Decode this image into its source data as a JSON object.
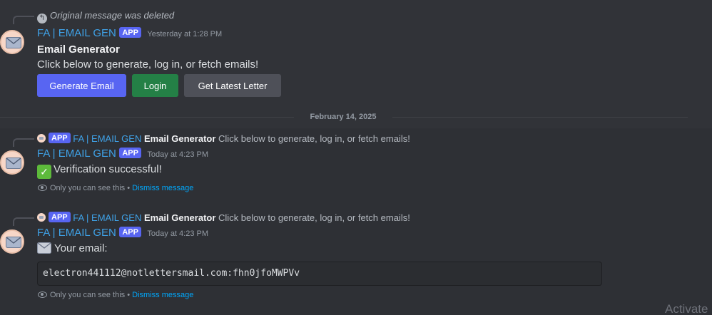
{
  "msg1": {
    "reply_text": "Original message was deleted",
    "username": "FA | EMAIL GEN",
    "tag": "APP",
    "timestamp": "Yesterday at 1:28 PM",
    "title": "Email Generator",
    "body": "Click below to generate, log in, or fetch emails!",
    "buttons": {
      "generate": "Generate Email",
      "login": "Login",
      "latest": "Get Latest Letter"
    }
  },
  "divider": {
    "date": "February 14, 2025"
  },
  "msg2": {
    "ref": {
      "tag": "APP",
      "name": "FA | EMAIL GEN",
      "bold": "Email Generator",
      "text": "Click below to generate, log in, or fetch emails!"
    },
    "username": "FA | EMAIL GEN",
    "tag": "APP",
    "timestamp": "Today at 4:23 PM",
    "emoji": "✅",
    "body": "Verification successful!",
    "ephemeral": "Only you can see this •",
    "dismiss": "Dismiss message"
  },
  "msg3": {
    "ref": {
      "tag": "APP",
      "name": "FA | EMAIL GEN",
      "bold": "Email Generator",
      "text": "Click below to generate, log in, or fetch emails!"
    },
    "username": "FA | EMAIL GEN",
    "tag": "APP",
    "timestamp": "Today at 4:23 PM",
    "body": "Your email:",
    "code": "electron441112@notlettersmail.com:fhn0jfoMWPVv",
    "ephemeral": "Only you can see this •",
    "dismiss": "Dismiss message"
  },
  "watermark": "Activate",
  "colors": {
    "background": "#313338",
    "highlight": "#2e3035",
    "blurple": "#5865f2",
    "green": "#248046",
    "grey_button": "#4e5058",
    "username": "#3fa2e8",
    "link": "#00a8fc"
  }
}
